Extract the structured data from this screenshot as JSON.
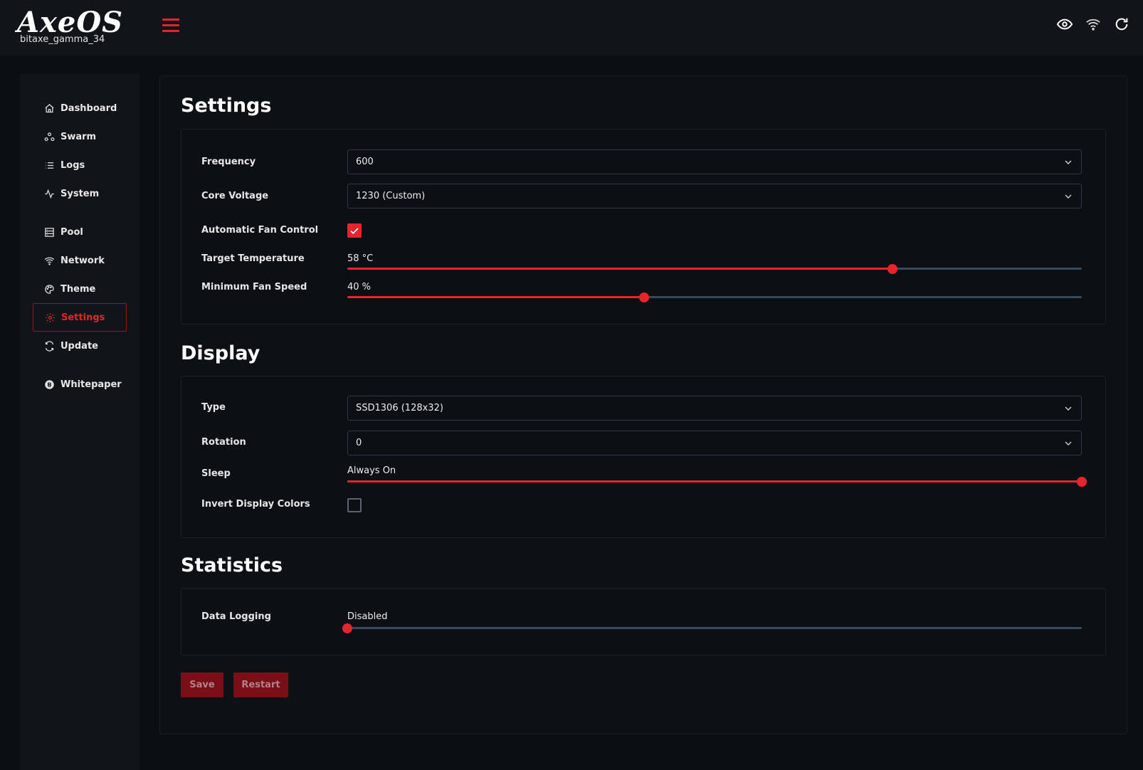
{
  "header": {
    "logo_text": "AxeOS",
    "hostname": "bitaxe_gamma_34",
    "icons": [
      "menu-icon",
      "eye-icon",
      "wifi-icon",
      "refresh-icon"
    ]
  },
  "sidebar": {
    "items": [
      {
        "label": "Dashboard",
        "icon": "home-icon"
      },
      {
        "label": "Swarm",
        "icon": "swarm-icon"
      },
      {
        "label": "Logs",
        "icon": "list-icon"
      },
      {
        "label": "System",
        "icon": "activity-icon"
      },
      {
        "label": "Pool",
        "icon": "server-icon"
      },
      {
        "label": "Network",
        "icon": "wifi-icon"
      },
      {
        "label": "Theme",
        "icon": "palette-icon"
      },
      {
        "label": "Settings",
        "icon": "gear-icon",
        "active": true
      },
      {
        "label": "Update",
        "icon": "sync-icon"
      },
      {
        "label": "Whitepaper",
        "icon": "bitcoin-icon"
      }
    ]
  },
  "settings": {
    "title": "Settings",
    "frequency": {
      "label": "Frequency",
      "value": "600"
    },
    "core_voltage": {
      "label": "Core Voltage",
      "value": "1230 (Custom)"
    },
    "auto_fan": {
      "label": "Automatic Fan Control",
      "checked": true
    },
    "target_temp": {
      "label": "Target Temperature",
      "value_text": "58 °C",
      "fraction": 0.742
    },
    "min_fan": {
      "label": "Minimum Fan Speed",
      "value_text": "40 %",
      "fraction": 0.404
    }
  },
  "display": {
    "title": "Display",
    "type": {
      "label": "Type",
      "value": "SSD1306 (128x32)"
    },
    "rotation": {
      "label": "Rotation",
      "value": "0"
    },
    "sleep": {
      "label": "Sleep",
      "value_text": "Always On",
      "fraction": 1.0
    },
    "invert": {
      "label": "Invert Display Colors",
      "checked": false
    }
  },
  "statistics": {
    "title": "Statistics",
    "data_logging": {
      "label": "Data Logging",
      "value_text": "Disabled",
      "fraction": 0.0
    }
  },
  "actions": {
    "save_label": "Save",
    "restart_label": "Restart"
  },
  "colors": {
    "accent": "#e5242b",
    "background": "#0b0e13",
    "panel": "#111418",
    "track": "#3a4a5c"
  }
}
